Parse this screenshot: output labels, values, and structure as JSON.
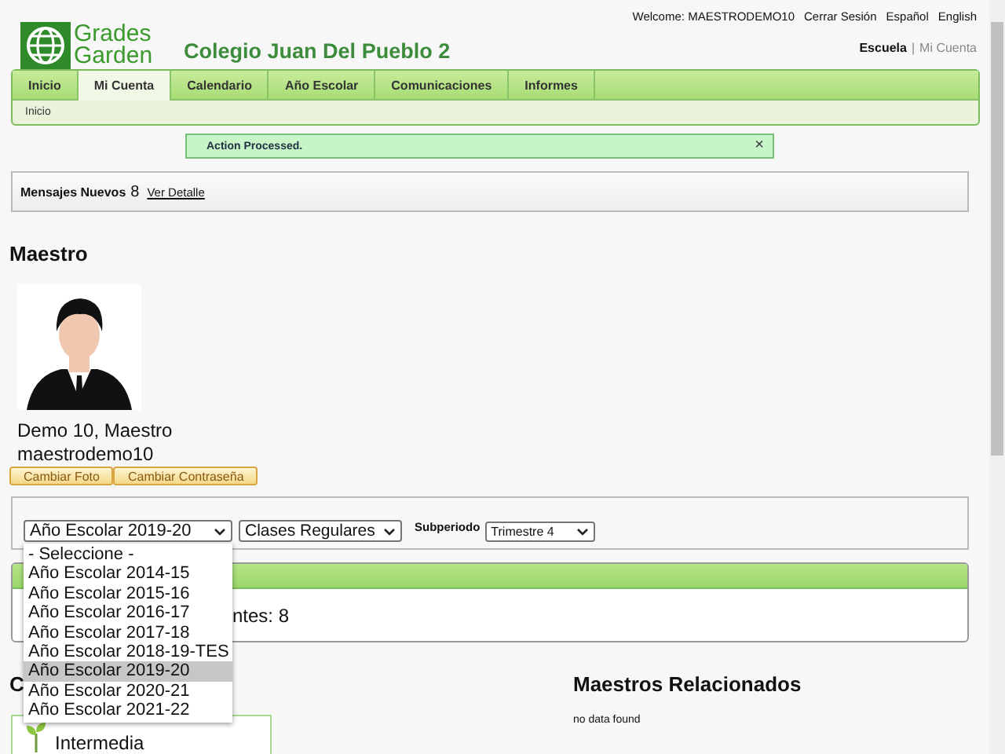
{
  "header": {
    "logo_top": "Grades",
    "logo_bottom": "Garden",
    "school": "Colegio Juan Del Pueblo 2",
    "welcome": "Welcome: MAESTRODEMO10",
    "links": [
      {
        "label": "Cerrar Sesión"
      },
      {
        "label": "Español"
      },
      {
        "label": "English"
      }
    ],
    "context": [
      {
        "label": "Escuela",
        "selected": true
      },
      {
        "label": "Mi Cuenta",
        "selected": false
      }
    ],
    "separator": "|"
  },
  "nav": {
    "tabs": [
      {
        "label": "Inicio",
        "selected": false
      },
      {
        "label": "Mi Cuenta",
        "selected": true
      },
      {
        "label": "Calendario",
        "selected": false
      },
      {
        "label": "Año Escolar",
        "selected": false
      },
      {
        "label": "Comunicaciones",
        "selected": false
      },
      {
        "label": "Informes",
        "selected": false
      }
    ],
    "subnav": [
      "Inicio"
    ]
  },
  "alert": {
    "text": "Action Processed.",
    "close": "×"
  },
  "messages": {
    "label": "Mensajes Nuevos",
    "count": "8",
    "link": "Ver Detalle"
  },
  "teacher": {
    "heading": "Maestro",
    "name": "Demo 10, Maestro",
    "username": "maestrodemo10",
    "buttons": [
      "Cambiar Foto",
      "Cambiar Contraseña"
    ]
  },
  "filters": {
    "year": "Año Escolar 2019-20",
    "classes": "Clases Regulares",
    "subperiod_label": "Subperiodo",
    "subperiod": "Trimestre 4",
    "year_options": [
      {
        "label": "- Seleccione -",
        "selected": false
      },
      {
        "label": "Año Escolar 2014-15",
        "selected": false
      },
      {
        "label": "Año Escolar 2015-16",
        "selected": false
      },
      {
        "label": "Año Escolar 2016-17",
        "selected": false
      },
      {
        "label": "Año Escolar 2017-18",
        "selected": false
      },
      {
        "label": "Año Escolar 2018-19-TES",
        "selected": false
      },
      {
        "label": "Año Escolar 2019-20",
        "selected": true
      },
      {
        "label": "Año Escolar 2020-21",
        "selected": false
      },
      {
        "label": "Año Escolar 2021-22",
        "selected": false
      }
    ]
  },
  "summary": {
    "text": "ntes: 8"
  },
  "courses": {
    "heading": "C",
    "items": [
      "Intermedia"
    ]
  },
  "related": {
    "heading": "Maestros Relacionados",
    "empty": "no data found"
  }
}
